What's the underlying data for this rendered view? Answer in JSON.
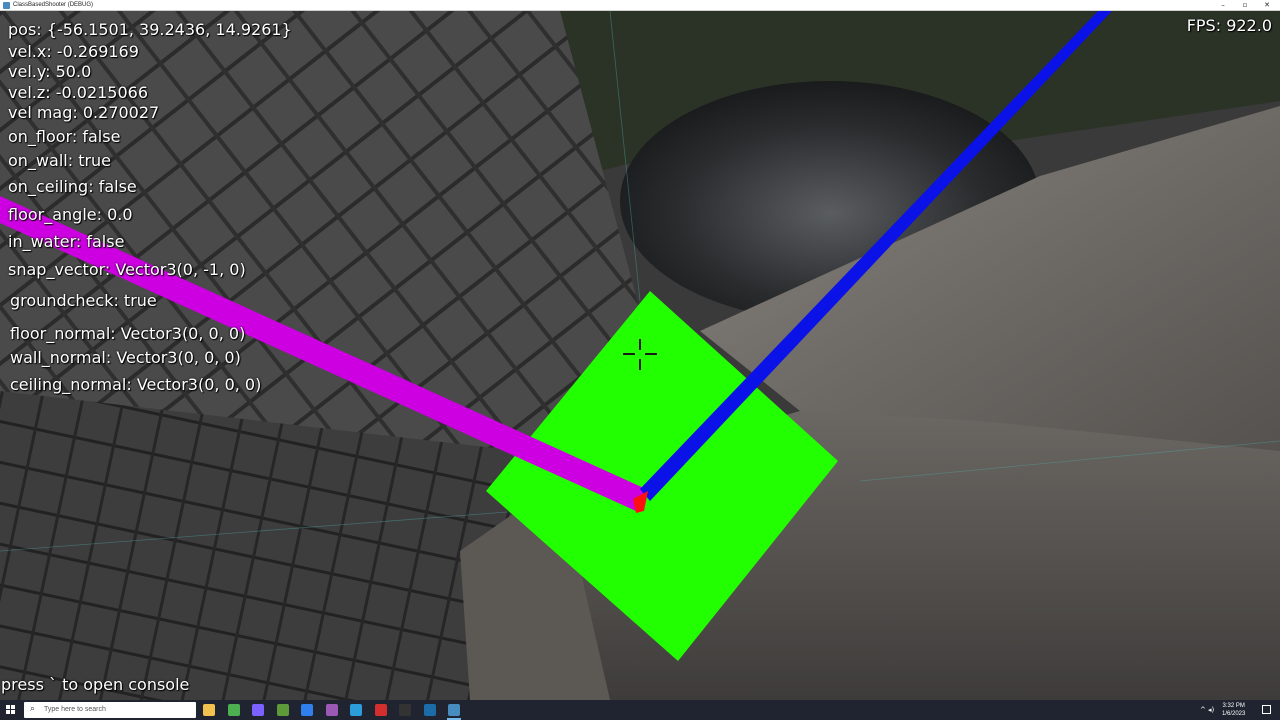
{
  "window": {
    "title": "ClassBasedShooter (DEBUG)",
    "minimize": "–",
    "maximize": "▫",
    "close": "✕"
  },
  "hud": {
    "fps": "FPS: 922.0",
    "pos": "pos: {-56.1501, 39.2436, 14.9261}",
    "vel_x": "vel.x: -0.269169",
    "vel_y": "vel.y: 50.0",
    "vel_z": "vel.z: -0.0215066",
    "vel_mag": "vel mag: 0.270027",
    "on_floor": "on_floor: false",
    "on_wall": "on_wall: true",
    "on_ceiling": "on_ceiling: false",
    "floor_angle": "floor_angle: 0.0",
    "in_water": "in_water: false",
    "snap_vector": "snap_vector: Vector3(0, -1, 0)",
    "groundcheck": "groundcheck: true",
    "floor_normal": "floor_normal: Vector3(0, 0, 0)",
    "wall_normal": "wall_normal: Vector3(0, 0, 0)",
    "ceiling_normal": "ceiling_normal: Vector3(0, 0, 0)",
    "console_hint": "press ` to open console"
  },
  "scene": {
    "plane_color": "#22ff00",
    "ray_magenta": "#cc00e0",
    "ray_blue": "#0a12e8",
    "ray_origin_color": "#ff1010",
    "crosshair_icon": "crosshair-icon"
  },
  "taskbar": {
    "search_placeholder": "Type here to search",
    "clock_time": "3:32 PM",
    "clock_date": "1/6/2023",
    "apps": [
      {
        "icon": "file-explorer-icon",
        "color": "#f2c14e"
      },
      {
        "icon": "chrome-icon",
        "color": "#4caf50"
      },
      {
        "icon": "app-icon",
        "color": "#7b61ff"
      },
      {
        "icon": "minecraft-icon",
        "color": "#5d9b3a"
      },
      {
        "icon": "app-blue-icon",
        "color": "#2f80ed"
      },
      {
        "icon": "github-icon",
        "color": "#9b59b6"
      },
      {
        "icon": "vscode-icon",
        "color": "#2d9cdb"
      },
      {
        "icon": "obs-icon",
        "color": "#d32f2f"
      },
      {
        "icon": "epic-icon",
        "color": "#333333"
      },
      {
        "icon": "steam-icon",
        "color": "#1b6ca8"
      },
      {
        "icon": "godot-icon",
        "color": "#478cbf"
      }
    ]
  }
}
